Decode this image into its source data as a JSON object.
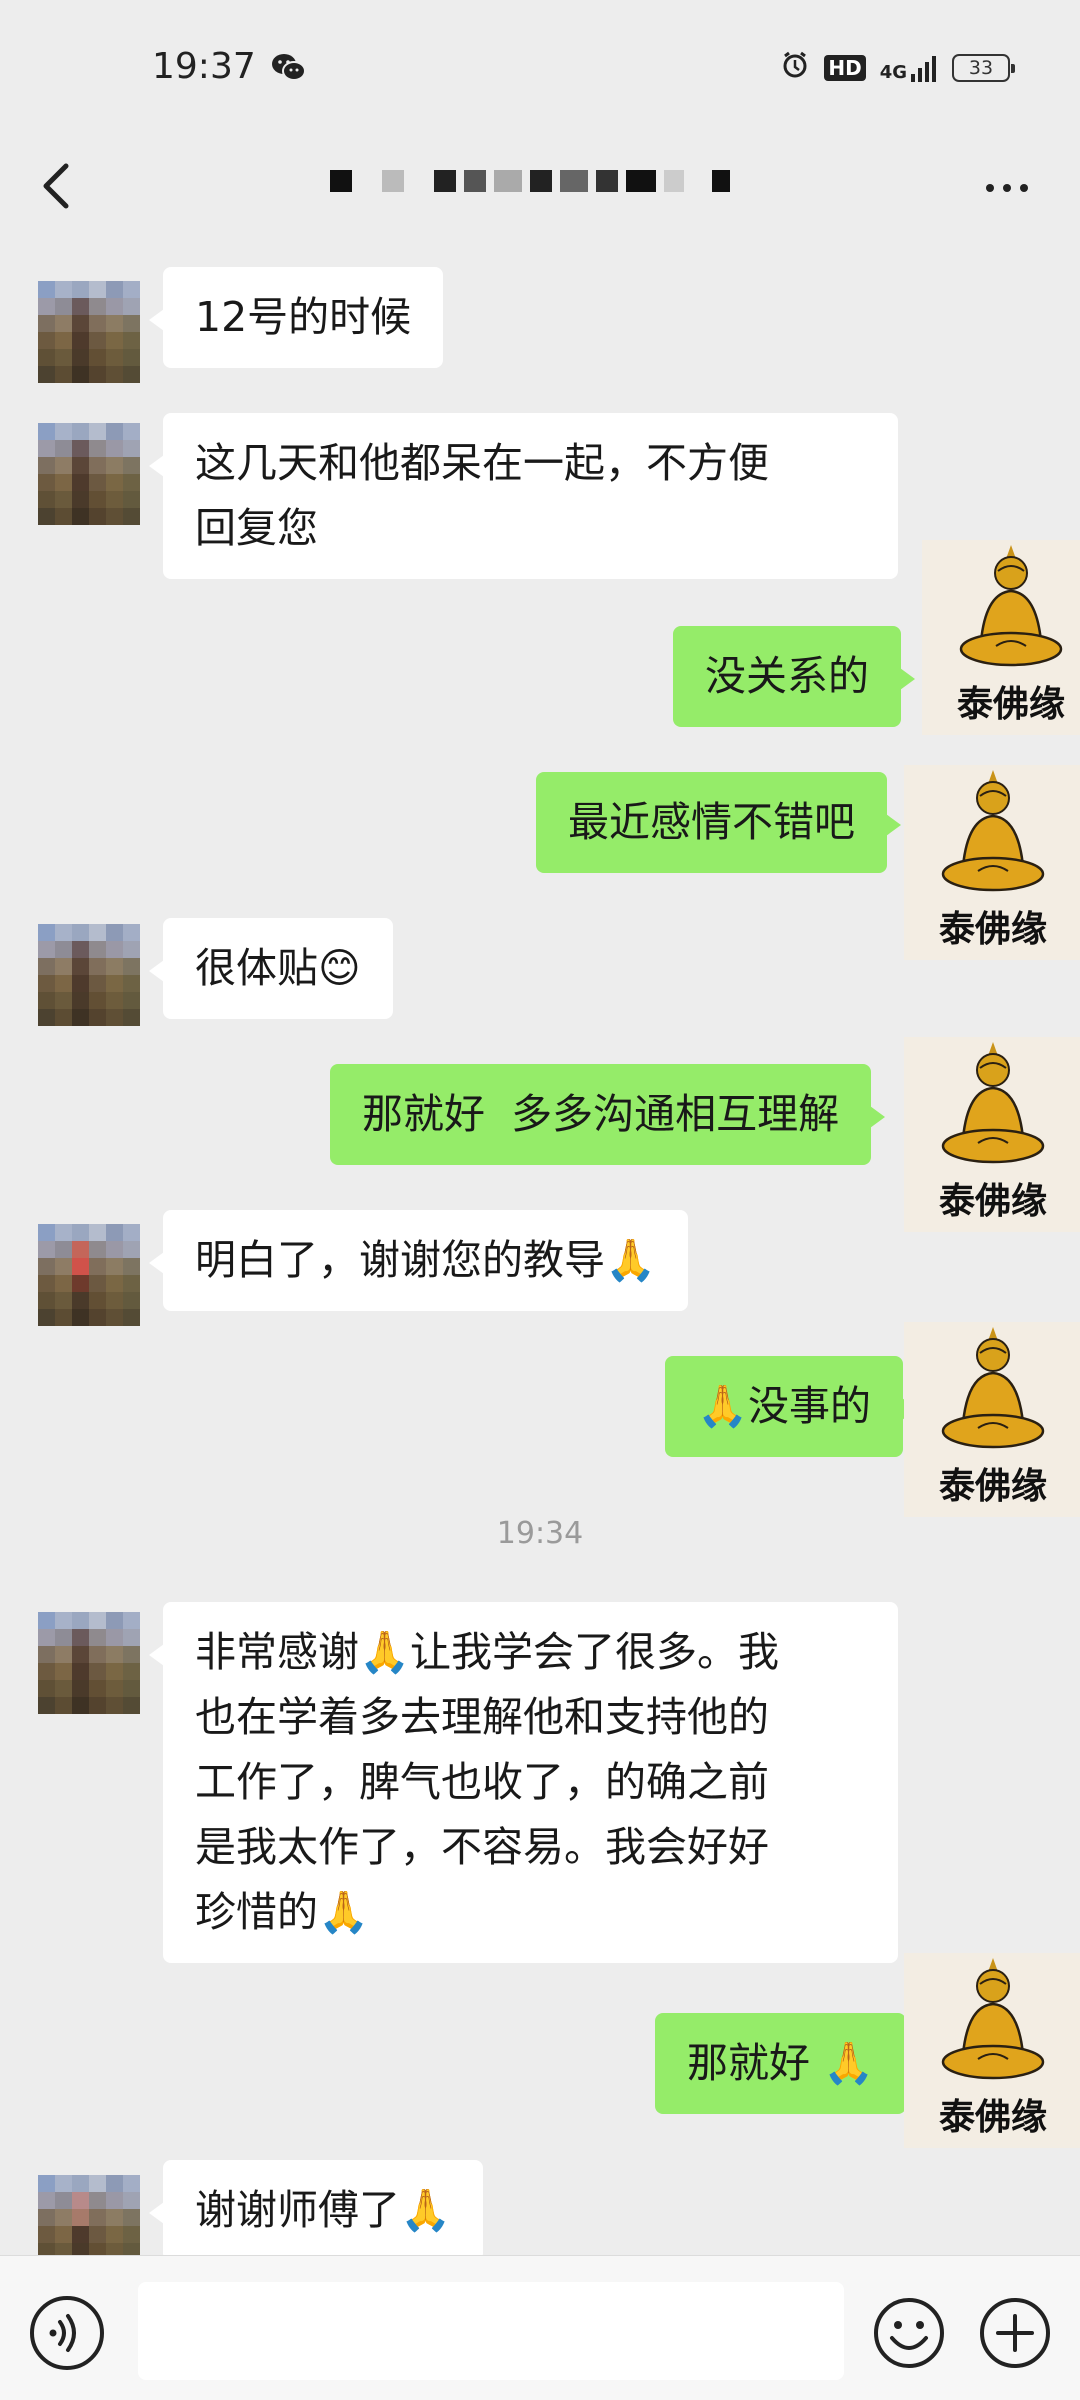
{
  "status_bar": {
    "time": "19:37",
    "hd": "HD",
    "network": "4G",
    "battery": "33"
  },
  "header": {
    "title": ""
  },
  "messages": [
    {
      "side": "left",
      "text": "12号的时候"
    },
    {
      "side": "left",
      "text": "这几天和他都呆在一起，不方便\n回复您"
    },
    {
      "side": "right",
      "text": "没关系的"
    },
    {
      "side": "right",
      "text": "最近感情不错吧"
    },
    {
      "side": "left",
      "text": "很体贴😊"
    },
    {
      "side": "right",
      "text": "那就好  多多沟通相互理解"
    },
    {
      "side": "left",
      "text": "明白了，谢谢您的教导🙏"
    },
    {
      "side": "right",
      "text": "🙏没事的"
    },
    {
      "side": "left",
      "text": "非常感谢🙏让我学会了很多。我\n也在学着多去理解他和支持他的\n工作了，脾气也收了，的确之前\n是我太作了，不容易。我会好好\n珍惜的🙏"
    },
    {
      "side": "right",
      "text": "那就好 🙏"
    },
    {
      "side": "left",
      "text": "谢谢师傅了🙏"
    }
  ],
  "timestamp": "19:34",
  "buddha_label": "泰佛缘",
  "input": {
    "value": "",
    "placeholder": ""
  },
  "icons": {
    "voice": "voice-icon",
    "emoji": "emoji-icon",
    "plus": "plus-icon",
    "back": "back-chevron-icon",
    "more": "more-icon"
  },
  "colors": {
    "background": "#ededed",
    "sent_bubble": "#95ec69",
    "received_bubble": "#ffffff"
  }
}
